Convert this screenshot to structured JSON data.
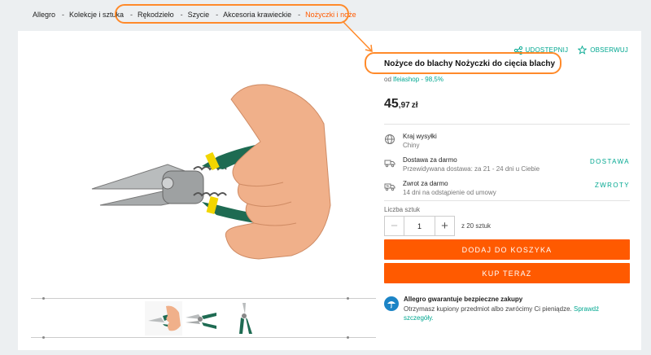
{
  "breadcrumb": {
    "items": [
      {
        "label": "Allegro"
      },
      {
        "label": "Kolekcje i sztuka"
      },
      {
        "label": "Rękodzieło"
      },
      {
        "label": "Szycie"
      },
      {
        "label": "Akcesoria krawieckie"
      },
      {
        "label": "Nożyczki i noże"
      }
    ],
    "separator": "-"
  },
  "product": {
    "title": "Nożyce do blachy Nożyczki do cięcia blachy",
    "seller_prefix": "od",
    "seller_name": "lfeiashop - 98,5%",
    "price_int": "45",
    "price_dec": ",97",
    "currency": "zł"
  },
  "actions": {
    "share_label": "UDOSTĘPNIJ",
    "follow_label": "OBSERWUJ"
  },
  "shipping": {
    "country_label": "Kraj wysyłki",
    "country_value": "Chiny",
    "delivery_label": "Dostawa za darmo",
    "delivery_detail": "Przewidywana dostawa: za 21 - 24 dni u Ciebie",
    "delivery_link": "DOSTAWA",
    "return_label": "Zwrot za darmo",
    "return_detail": "14 dni na odstąpienie od umowy",
    "return_link": "ZWROTY"
  },
  "quantity": {
    "label": "Liczba sztuk",
    "value": "1",
    "minus": "−",
    "plus": "+",
    "available": "z 20 sztuk"
  },
  "buttons": {
    "add_to_cart": "DODAJ DO KOSZYKA",
    "buy_now": "KUP TERAZ"
  },
  "guarantee": {
    "title": "Allegro gwarantuje bezpieczne zakupy",
    "text": "Otrzymasz kupiony przedmiot albo zwrócimy Ci pieniądze.",
    "link": "Sprawdź szczegóły."
  },
  "colors": {
    "accent": "#ff5a00",
    "link": "#00a790",
    "highlight": "#ff8a2a",
    "handle_green": "#1e6b52",
    "handle_yellow": "#f2d600"
  }
}
